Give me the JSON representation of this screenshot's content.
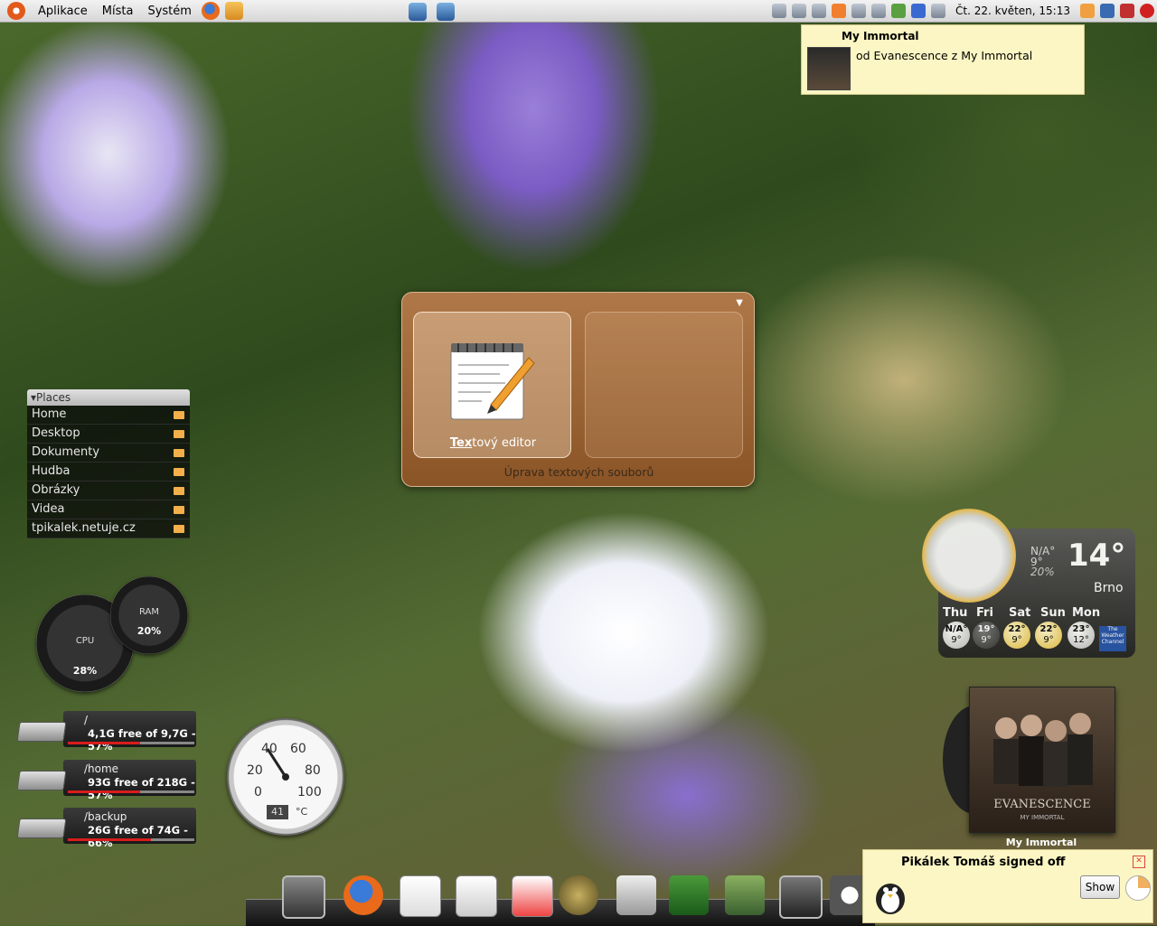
{
  "panel": {
    "menus": [
      "Aplikace",
      "Místa",
      "Systém"
    ],
    "clock": "Čt. 22. květen, 15:13"
  },
  "notification": {
    "title": "My Immortal",
    "body": "od Evanescence z My Immortal"
  },
  "places": {
    "title": "Places",
    "items": [
      "Home",
      "Desktop",
      "Dokumenty",
      "Hudba",
      "Obrázky",
      "Videa",
      "tpikalek.netuje.cz"
    ]
  },
  "launcher": {
    "selected_label_match": "Tex",
    "selected_label_rest": "tový editor",
    "description": "Úprava textových souborů"
  },
  "gauges": {
    "cpu_label": "CPU",
    "cpu_value": "28%",
    "ram_label": "RAM",
    "ram_value": "20%"
  },
  "disks": [
    {
      "mount": "/",
      "info": "4,1G free of 9,7G - 57%",
      "used_percent": 57
    },
    {
      "mount": "/home",
      "info": "93G free of 218G - 57%",
      "used_percent": 57
    },
    {
      "mount": "/backup",
      "info": "26G free of 74G - 66%",
      "used_percent": 66
    }
  ],
  "thermometer": {
    "scale": [
      "40",
      "60",
      "20",
      "80",
      "0",
      "100"
    ],
    "unit": "°C",
    "reading": "41"
  },
  "weather": {
    "now_hi": "N/A°",
    "now_lo": "9°",
    "now_precip": "20%",
    "temp": "14°",
    "city": "Brno",
    "days": [
      {
        "name": "Thu",
        "hi": "N/A°",
        "lo": "9°"
      },
      {
        "name": "Fri",
        "hi": "19°",
        "lo": "9°"
      },
      {
        "name": "Sat",
        "hi": "22°",
        "lo": "9°"
      },
      {
        "name": "Sun",
        "hi": "22°",
        "lo": "9°"
      },
      {
        "name": "Mon",
        "hi": "23°",
        "lo": "12°"
      }
    ],
    "provider": "The Weather Channel"
  },
  "album": {
    "art_text": "EVANESCENCE",
    "art_sub": "MY IMMORTAL",
    "label": "My Immortal"
  },
  "toast": {
    "message": "Pikálek Tomáš signed off",
    "show_label": "Show"
  },
  "dock": [
    "terminal",
    "firefox",
    "text-editor",
    "document-viewer",
    "office",
    "gimp",
    "audio",
    "dictionary",
    "books",
    "terminal-2",
    "camera"
  ]
}
